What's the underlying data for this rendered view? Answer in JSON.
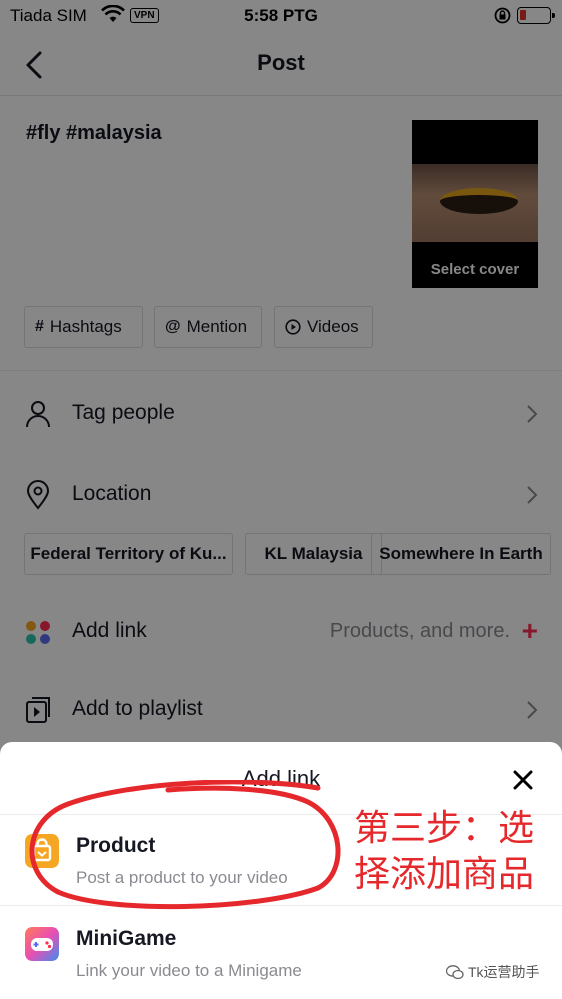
{
  "status_bar": {
    "carrier": "Tiada SIM",
    "vpn": "VPN",
    "time": "5:58 PTG"
  },
  "header": {
    "title": "Post"
  },
  "caption": "#fly #malaysia",
  "cover": {
    "label": "Select cover"
  },
  "chips": [
    {
      "icon": "hashtag-icon",
      "label": "Hashtags"
    },
    {
      "icon": "at-icon",
      "label": "Mention"
    },
    {
      "icon": "play-circle-icon",
      "label": "Videos"
    }
  ],
  "rows": {
    "tag_people": {
      "label": "Tag people"
    },
    "location": {
      "label": "Location"
    },
    "add_link": {
      "label": "Add link",
      "sub": "Products, and more.",
      "plus": "+"
    },
    "playlist": {
      "label": "Add to playlist"
    }
  },
  "location_tags": [
    "Federal Territory of Ku...",
    "KL Malaysia",
    "Somewhere In Earth"
  ],
  "sheet": {
    "title": "Add link",
    "options": [
      {
        "title": "Product",
        "subtitle": "Post a product to your video",
        "icon": "product-bag-icon",
        "color": "#f5a623"
      },
      {
        "title": "MiniGame",
        "subtitle": "Link your video to a Minigame",
        "icon": "gamepad-icon",
        "color": "#5b6cf0"
      }
    ]
  },
  "annotation": {
    "text_line1": "第三步：选",
    "text_line2": "择添加商品",
    "color": "#e5282c"
  },
  "watermark": "Tk运营助手",
  "colors": {
    "accent": "#fe2c55",
    "dim_overlay": "rgba(0,0,0,0.47)"
  }
}
